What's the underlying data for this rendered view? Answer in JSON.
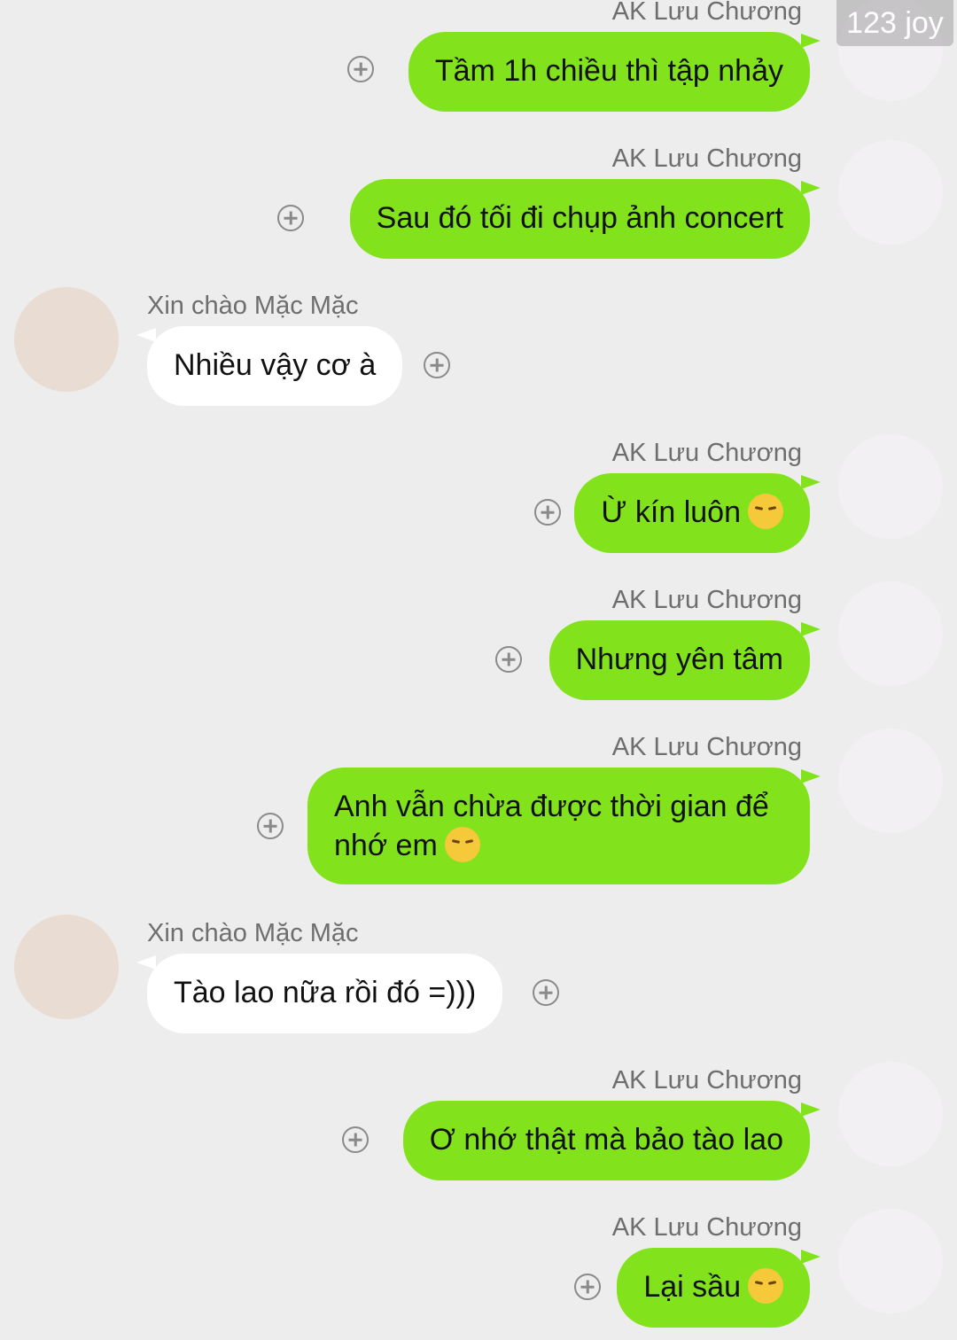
{
  "watermark": "123 joy",
  "contacts": {
    "me": "AK Lưu Chương",
    "them": "Xin chào Mặc Mặc"
  },
  "messages": [
    {
      "sender": "AK Lưu Chương",
      "side": "right",
      "lines": [
        "Tầm 1h chiều thì tập nhảy"
      ]
    },
    {
      "sender": "AK Lưu Chương",
      "side": "right",
      "lines": [
        "Sau đó tối đi chụp ảnh concert"
      ]
    },
    {
      "sender": "Xin chào Mặc Mặc",
      "side": "left",
      "lines": [
        "Nhiều vậy cơ à"
      ]
    },
    {
      "sender": "AK Lưu Chương",
      "side": "right",
      "lines": [
        "Ừ kín luôn"
      ],
      "emoji": "pensive-face"
    },
    {
      "sender": "AK Lưu Chương",
      "side": "right",
      "lines": [
        "Nhưng yên tâm"
      ]
    },
    {
      "sender": "AK Lưu Chương",
      "side": "right",
      "lines": [
        "Anh vẫn chừa được thời gian để",
        "nhớ em"
      ],
      "emoji": "pensive-face"
    },
    {
      "sender": "Xin chào Mặc Mặc",
      "side": "left",
      "lines": [
        "Tào lao nữa rồi đó =)))"
      ]
    },
    {
      "sender": "AK Lưu Chương",
      "side": "right",
      "lines": [
        "Ơ nhớ thật mà bảo tào lao"
      ]
    },
    {
      "sender": "AK Lưu Chương",
      "side": "right",
      "lines": [
        "Lại sầu"
      ],
      "emoji": "pensive-face"
    }
  ]
}
